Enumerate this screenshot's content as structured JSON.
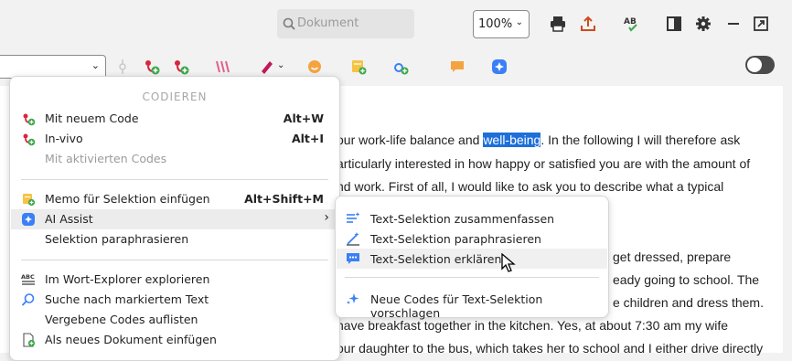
{
  "toolbar": {
    "search_placeholder": "Dokument",
    "zoom_value": "100%",
    "icons": [
      "search-icon",
      "print-icon",
      "export-icon",
      "spellcheck-icon",
      "panel-toggle-icon",
      "settings-icon",
      "minimize-icon",
      "popout-icon"
    ]
  },
  "document": {
    "lines": [
      {
        "pre": "our work-life balance and ",
        "highlight": "well-being",
        "post": ". In the following I will therefore ask"
      },
      {
        "pre": "articularly interested in how happy or satisfied you are with the amount of",
        "highlight": "",
        "post": ""
      },
      {
        "pre": "nd work. First of all, I would like to ask you to describe what a typical",
        "highlight": "",
        "post": ""
      },
      {
        "pre": "get dressed, prepare",
        "highlight": "",
        "post": ""
      },
      {
        "pre": "eady going to school. The",
        "highlight": "",
        "post": ""
      },
      {
        "pre": "e children and dress them.",
        "highlight": "",
        "post": ""
      },
      {
        "pre": "have breakfast together in the kitchen. Yes, at about 7:30 am my wife",
        "highlight": "",
        "post": ""
      },
      {
        "pre": "our daughter to the bus, which takes her to school and I either drive directly",
        "highlight": "",
        "post": ""
      }
    ]
  },
  "menu": {
    "header": "CODIEREN",
    "items": [
      {
        "label": "Mit neuem Code",
        "shortcut": "Alt+W"
      },
      {
        "label": "In-vivo",
        "shortcut": "Alt+I"
      },
      {
        "label": "Mit aktivierten Codes",
        "shortcut": ""
      },
      {
        "label": "Memo für Selektion einfügen",
        "shortcut": "Alt+Shift+M"
      },
      {
        "label": "AI Assist",
        "shortcut": ""
      },
      {
        "label": "Selektion paraphrasieren",
        "shortcut": ""
      },
      {
        "label": "Im Wort-Explorer explorieren",
        "shortcut": ""
      },
      {
        "label": "Suche nach markiertem Text",
        "shortcut": ""
      },
      {
        "label": "Vergebene Codes auflisten",
        "shortcut": ""
      },
      {
        "label": "Als neues Dokument einfügen",
        "shortcut": ""
      }
    ],
    "submenu_arrow": "›"
  },
  "submenu": {
    "items": [
      {
        "label": "Text-Selektion zusammenfassen"
      },
      {
        "label": "Text-Selektion paraphrasieren"
      },
      {
        "label": "Text-Selektion erklären"
      },
      {
        "label": "Neue Codes für Text-Selektion vorschlagen"
      }
    ]
  },
  "colors": {
    "accent": "#1e6fd9",
    "code_red": "#d7263d",
    "code_green": "#3aa84a",
    "ai_blue": "#3a7ff6"
  }
}
